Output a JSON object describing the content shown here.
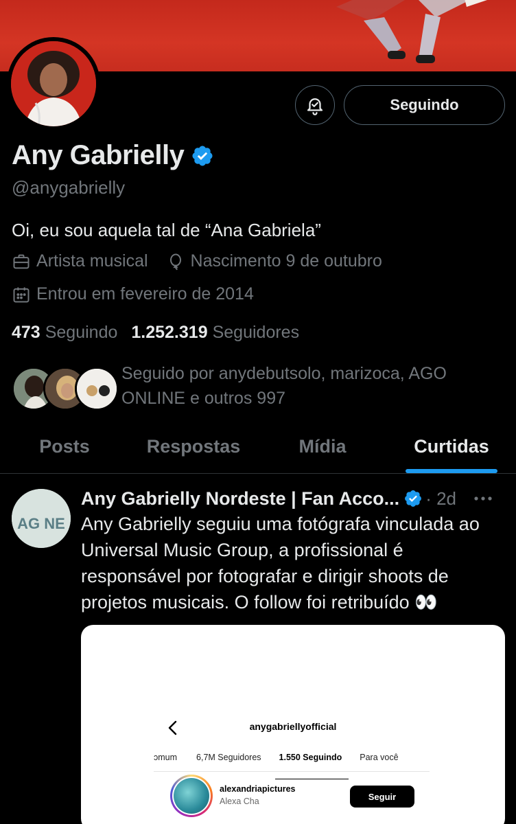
{
  "profile": {
    "name": "Any Gabrielly",
    "handle": "@anygabrielly",
    "bio": "Oi, eu sou aquela tal de “Ana Gabriela”",
    "category": "Artista musical",
    "birthday": "Nascimento 9 de outubro",
    "joined": "Entrou em fevereiro de 2014",
    "following_count": "473",
    "following_label": "Seguindo",
    "followers_count": "1.252.319",
    "followers_label": "Seguidores",
    "followed_by": "Seguido por anydebutsolo, marizoca, AGO ONLINE e outros 997"
  },
  "actions": {
    "follow_state": "Seguindo"
  },
  "tabs": [
    {
      "label": "Posts",
      "active": false
    },
    {
      "label": "Respostas",
      "active": false
    },
    {
      "label": "Mídia",
      "active": false
    },
    {
      "label": "Curtidas",
      "active": true
    }
  ],
  "post": {
    "author": "Any Gabrielly Nordeste | Fan Acco...",
    "avatar_text": "AG NE",
    "time": "· 2d",
    "text": "Any Gabrielly seguiu uma fotógrafa vinculada ao Universal Music Group, a profissional é responsável por fotografar e dirigir shoots de projetos musicais. O follow foi retribuído 👀",
    "media": {
      "title": "anygabriellyofficial",
      "tabs": [
        "ɔmum",
        "6,7M Seguidores",
        "1.550 Seguindo",
        "Para você"
      ],
      "active_tab": 2,
      "user": "alexandriapictures",
      "user_sub": "Alexa Cha",
      "follow_label": "Seguir"
    }
  },
  "colors": {
    "accent": "#1d9bf0",
    "banner": "#d43524",
    "muted": "#71767b",
    "text": "#e7e9ea"
  }
}
